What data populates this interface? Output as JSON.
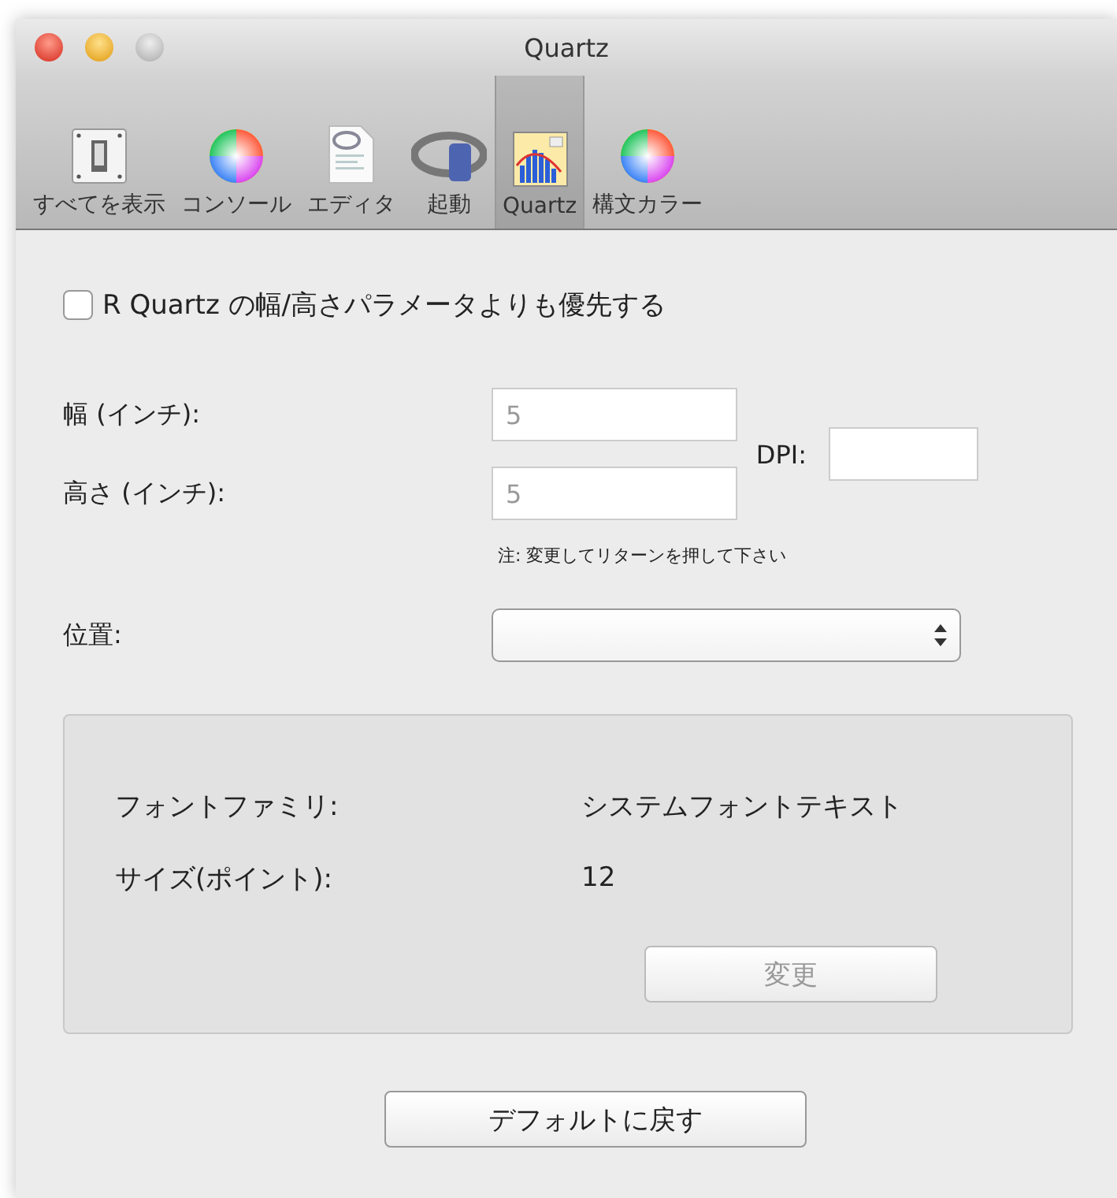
{
  "window": {
    "title": "Quartz"
  },
  "toolbar": [
    {
      "label": "すべてを表示",
      "kind": "switch",
      "selected": false
    },
    {
      "label": "コンソール",
      "kind": "wheel",
      "selected": false
    },
    {
      "label": "エディタ",
      "kind": "document",
      "selected": false
    },
    {
      "label": "起動",
      "kind": "ring",
      "selected": false
    },
    {
      "label": "Quartz",
      "kind": "chart",
      "selected": true
    },
    {
      "label": "構文カラー",
      "kind": "wheel",
      "selected": false
    }
  ],
  "override": {
    "label": "R Quartz の幅/高さパラメータよりも優先する",
    "checked": false
  },
  "width": {
    "label": "幅 (インチ):",
    "value": "5"
  },
  "height": {
    "label": "高さ (インチ):",
    "value": "5"
  },
  "dpi": {
    "label": "DPI:"
  },
  "note": "注: 変更してリターンを押して下さい",
  "position": {
    "label": "位置:"
  },
  "font_group": {
    "family_label": "フォントファミリ:",
    "family_value": "システムフォントテキスト",
    "size_label": "サイズ(ポイント):",
    "size_value": "12",
    "change_button": {
      "label": "変更",
      "disabled": true
    }
  },
  "reset_button": "デフォルトに戻す"
}
